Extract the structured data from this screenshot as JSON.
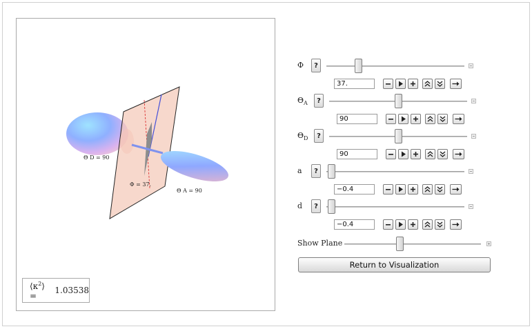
{
  "visualization": {
    "kappa_label": "⟨κ",
    "kappa_power": "2",
    "kappa_close": "⟩ =",
    "kappa_value": "1.03538",
    "scene_labels": {
      "theta_d": "Θ D = 90",
      "phi": "Φ = 37.",
      "theta_a": "Θ A = 90"
    }
  },
  "controls": [
    {
      "label": "Φ",
      "label_sub": "",
      "value": "37.",
      "slider_fraction": 0.21,
      "help": "?"
    },
    {
      "label": "Θ",
      "label_sub": "A",
      "value": "90",
      "slider_fraction": 0.5,
      "help": "?"
    },
    {
      "label": "Θ",
      "label_sub": "D",
      "value": "90",
      "slider_fraction": 0.5,
      "help": "?"
    },
    {
      "label": "a",
      "label_sub": "",
      "value": "−0.4",
      "slider_fraction": 0.0,
      "help": "?"
    },
    {
      "label": "d",
      "label_sub": "",
      "value": "−0.4",
      "slider_fraction": 0.0,
      "help": "?"
    }
  ],
  "show_plane": {
    "label": "Show Plane",
    "slider_fraction": 0.4
  },
  "return_button": {
    "label": "Return to Visualization"
  },
  "icons": {
    "anim_buttons": [
      "minus-icon",
      "play-icon",
      "plus-icon",
      "faster-icon",
      "slower-icon",
      "direction-icon"
    ]
  }
}
